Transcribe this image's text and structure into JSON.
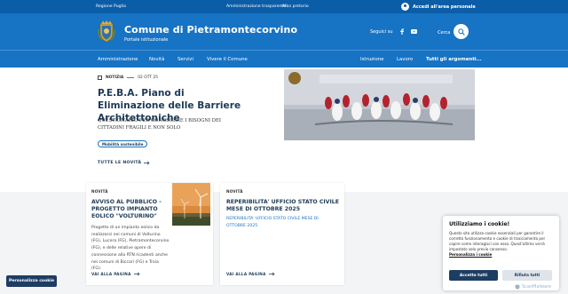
{
  "topbar": {
    "region": "Regione Puglia",
    "transparency": "Amministrazione trasparente",
    "albo": "Albo pretorio",
    "login": "Accedi all'area personale"
  },
  "header": {
    "title": "Comune di Pietramontecorvino",
    "subtitle": "Portale istituzionale",
    "follow": "Seguici su",
    "search": "Cerca"
  },
  "nav": {
    "items": [
      "Amministrazione",
      "Novità",
      "Servizi",
      "Vivere il Comune"
    ],
    "right_items": [
      "Istruzione",
      "Lavoro",
      "Tutti gli argomenti..."
    ]
  },
  "hero": {
    "category": "NOTIZIA",
    "date": "02 OTT 25",
    "title": "P.E.B.A. Piano di Eliminazione delle Barriere Architettoniche",
    "description": "QUESTIONARIO PER CONOSCERE I BISOGNI DEI CITTADINI FRAGILI E NON SOLO",
    "tag": "Mobilità sostenibile",
    "all_news": "TUTTE LE NOVITÀ"
  },
  "cards": [
    {
      "category": "NOVITÀ",
      "title": "AVVISO AL PUBBLICO - PROGETTO IMPIANTO EOLICO \"VOLTURINO\"",
      "body": "Progetto di un impianto eolico da realizzarsi nei comuni di Volturino (FG), Lucera (FG), Pietramontecorvino (FG), e delle relative opere di connessione alla RTN ricadenti anche nei comuni di Biccari (FG) e Troia (FG).",
      "link": "VAI ALLA PAGINA"
    },
    {
      "category": "NOVITÀ",
      "title": "REPERIBILITA' UFFICIO STATO CIVILE MESE DI OTTOBRE 2025",
      "body": "REPERIBILITA' UFFICIO STATO CIVILE MESE DI OTTOBRE 2025",
      "link": "VAI ALLA PAGINA"
    }
  ],
  "cookie": {
    "title": "Utilizziamo i cookie!",
    "text": "Questo sito utilizza cookie essenziali per garantire il corretto funzionamento e cookie di tracciamento per capire come interagisci con esso. Quest'ultimo verrà impostato solo previo consenso.",
    "link": "Personalizza i cookie",
    "accept": "Accetta tutti",
    "reject": "Rifiuta tutti",
    "watermark": "ScanMalware",
    "customize_button": "Personalizza cookie"
  },
  "colors": {
    "primary": "#1773c4",
    "topbar": "#0b5da8",
    "dark": "#1d3d63"
  }
}
